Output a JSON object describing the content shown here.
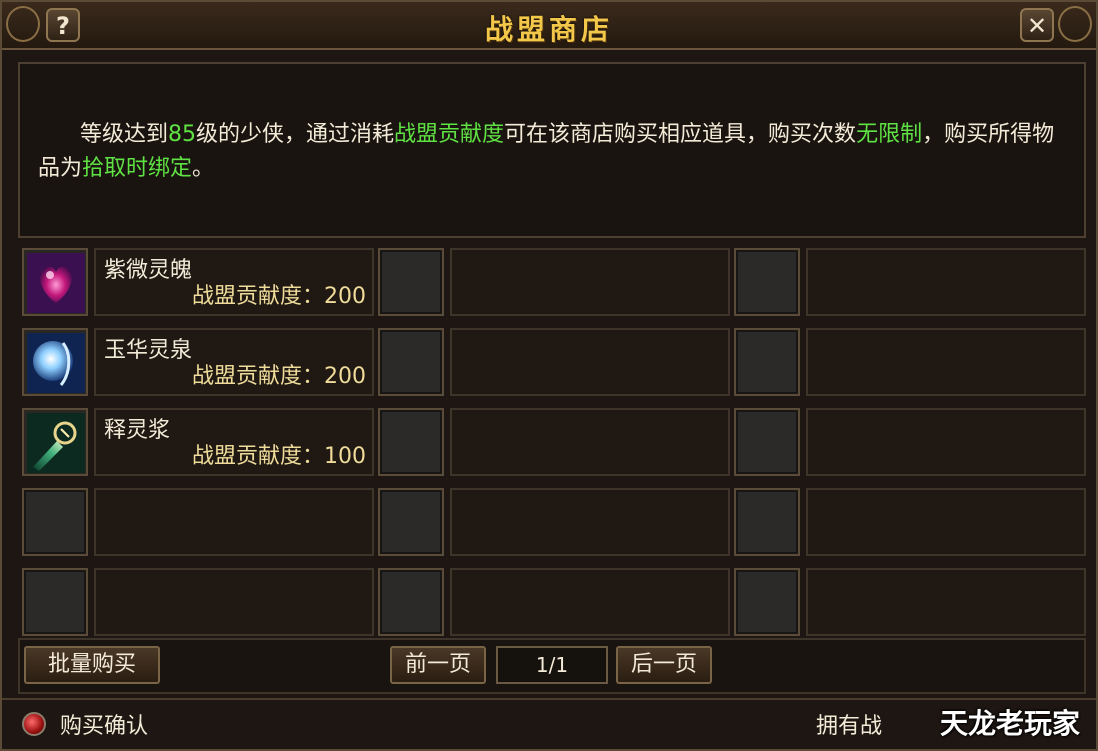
{
  "window": {
    "title": "战盟商店",
    "help_label": "?",
    "close_label": "✕"
  },
  "info": {
    "seg1": "等级达到",
    "level": "85",
    "seg2": "级的少侠，通过消耗",
    "currency": "战盟贡献度",
    "seg3": "可在该商店购买相应道具，购买次数",
    "limit": "无限制",
    "seg4": "，购买所得物品为",
    "bind": "拾取时绑定",
    "seg5": "。"
  },
  "items": [
    {
      "name": "紫微灵魄",
      "cost": "战盟贡献度：200",
      "icon": "purple-gem-icon"
    },
    {
      "name": "玉华灵泉",
      "cost": "战盟贡献度：200",
      "icon": "blue-spring-icon"
    },
    {
      "name": "释灵浆",
      "cost": "战盟贡献度：100",
      "icon": "green-vial-icon"
    }
  ],
  "controls": {
    "bulk_buy": "批量购买",
    "prev_page": "前一页",
    "page": "1/1",
    "next_page": "后一页"
  },
  "footer": {
    "confirm_label": "购买确认",
    "own_label": "拥有战",
    "watermark": "天龙老玩家"
  },
  "colors": {
    "title": "#f2c74a",
    "highlight": "#5fe243",
    "cost": "#f0dc9a"
  }
}
